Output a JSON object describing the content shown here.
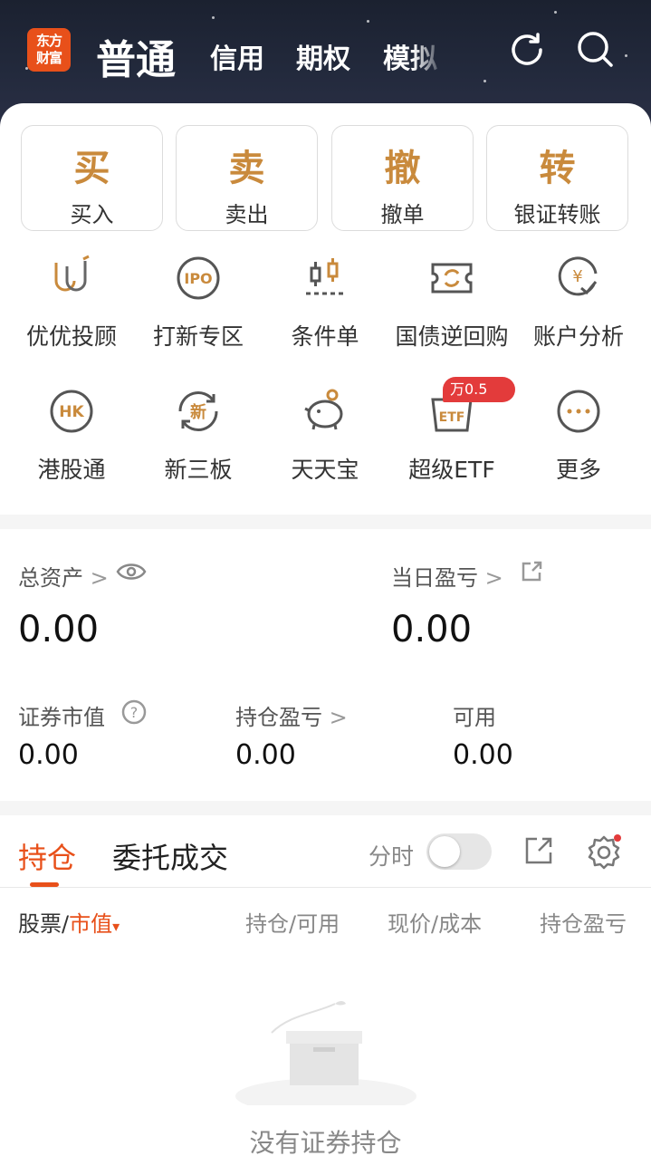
{
  "header": {
    "logo_line1": "东方",
    "logo_line2": "财富",
    "tabs": [
      "普通",
      "信用",
      "期权",
      "模拟"
    ],
    "refresh_icon": "refresh-icon",
    "search_icon": "search-icon"
  },
  "trade_buttons": [
    {
      "char": "买",
      "label": "买入"
    },
    {
      "char": "卖",
      "label": "卖出"
    },
    {
      "char": "撤",
      "label": "撤单"
    },
    {
      "char": "转",
      "label": "银证转账"
    }
  ],
  "grid": {
    "row1": [
      {
        "label": "优优投顾",
        "icon": "advisor-icon"
      },
      {
        "label": "打新专区",
        "icon": "ipo-icon",
        "icon_text": "IPO"
      },
      {
        "label": "条件单",
        "icon": "condition-order-icon"
      },
      {
        "label": "国债逆回购",
        "icon": "repo-icon"
      },
      {
        "label": "账户分析",
        "icon": "account-analysis-icon"
      }
    ],
    "row2": [
      {
        "label": "港股通",
        "icon": "hk-connect-icon",
        "icon_text": "HK"
      },
      {
        "label": "新三板",
        "icon": "neeq-icon",
        "icon_text": "新"
      },
      {
        "label": "天天宝",
        "icon": "piggy-bank-icon"
      },
      {
        "label": "超级ETF",
        "icon": "etf-icon",
        "icon_text": "ETF",
        "badge": "万0.5"
      },
      {
        "label": "更多",
        "icon": "more-icon"
      }
    ]
  },
  "assets": {
    "total_label": "总资产",
    "total_value": "0.00",
    "daily_pl_label": "当日盈亏",
    "daily_pl_value": "0.00",
    "market_value_label": "证券市值",
    "market_value": "0.00",
    "position_pl_label": "持仓盈亏",
    "position_pl": "0.00",
    "available_label": "可用",
    "available": "0.00"
  },
  "positions": {
    "tab_holdings": "持仓",
    "tab_orders": "委托成交",
    "intraday_label": "分时",
    "intraday_on": false,
    "col_stock": "股票/",
    "col_market_value": "市值",
    "col_qty": "持仓/可用",
    "col_price": "现价/成本",
    "col_pl": "持仓盈亏",
    "empty_text": "没有证券持仓"
  },
  "colors": {
    "accent": "#e8501a",
    "gold": "#c98a3c",
    "badge": "#e33b3b"
  }
}
